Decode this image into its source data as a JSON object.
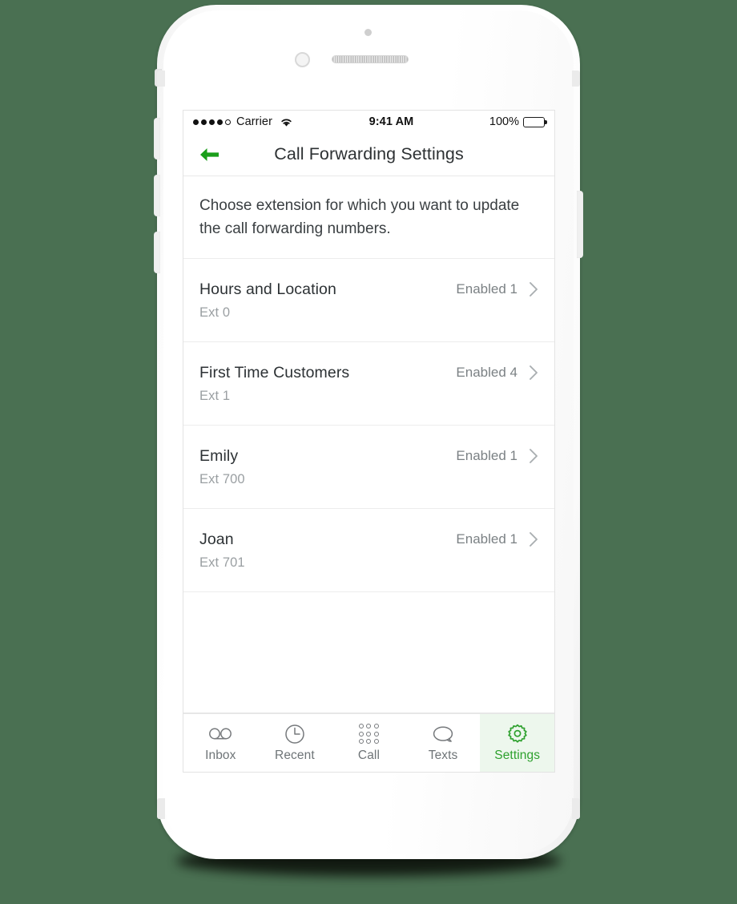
{
  "status_bar": {
    "carrier": "Carrier",
    "signal_dots_filled": 4,
    "signal_dots_total": 5,
    "wifi_icon": "wifi-icon",
    "time": "9:41 AM",
    "battery_percent": "100%",
    "battery_color": "#4cd964"
  },
  "nav": {
    "back_icon": "back-arrow-icon",
    "back_icon_color": "#1a9e1a",
    "title": "Call Forwarding Settings"
  },
  "description": {
    "text": "Choose extension for which you want to update the call forwarding numbers."
  },
  "extensions": [
    {
      "name": "Hours and Location",
      "extension": "Ext 0",
      "status": "Enabled 1",
      "chevron": "chevron-right-icon"
    },
    {
      "name": "First Time Customers",
      "extension": "Ext 1",
      "status": "Enabled 4",
      "chevron": "chevron-right-icon"
    },
    {
      "name": "Emily",
      "extension": "Ext 700",
      "status": "Enabled 1",
      "chevron": "chevron-right-icon"
    },
    {
      "name": "Joan",
      "extension": "Ext 701",
      "status": "Enabled 1",
      "chevron": "chevron-right-icon"
    }
  ],
  "tabs": [
    {
      "label": "Inbox",
      "icon": "voicemail-icon",
      "active": false
    },
    {
      "label": "Recent",
      "icon": "clock-icon",
      "active": false
    },
    {
      "label": "Call",
      "icon": "dialpad-icon",
      "active": false
    },
    {
      "label": "Texts",
      "icon": "speech-bubble-icon",
      "active": false
    },
    {
      "label": "Settings",
      "icon": "gear-icon",
      "active": true
    }
  ],
  "theme": {
    "page_background": "#4a7052",
    "accent_green": "#2ea12e",
    "active_tab_background": "#edf7ed"
  }
}
